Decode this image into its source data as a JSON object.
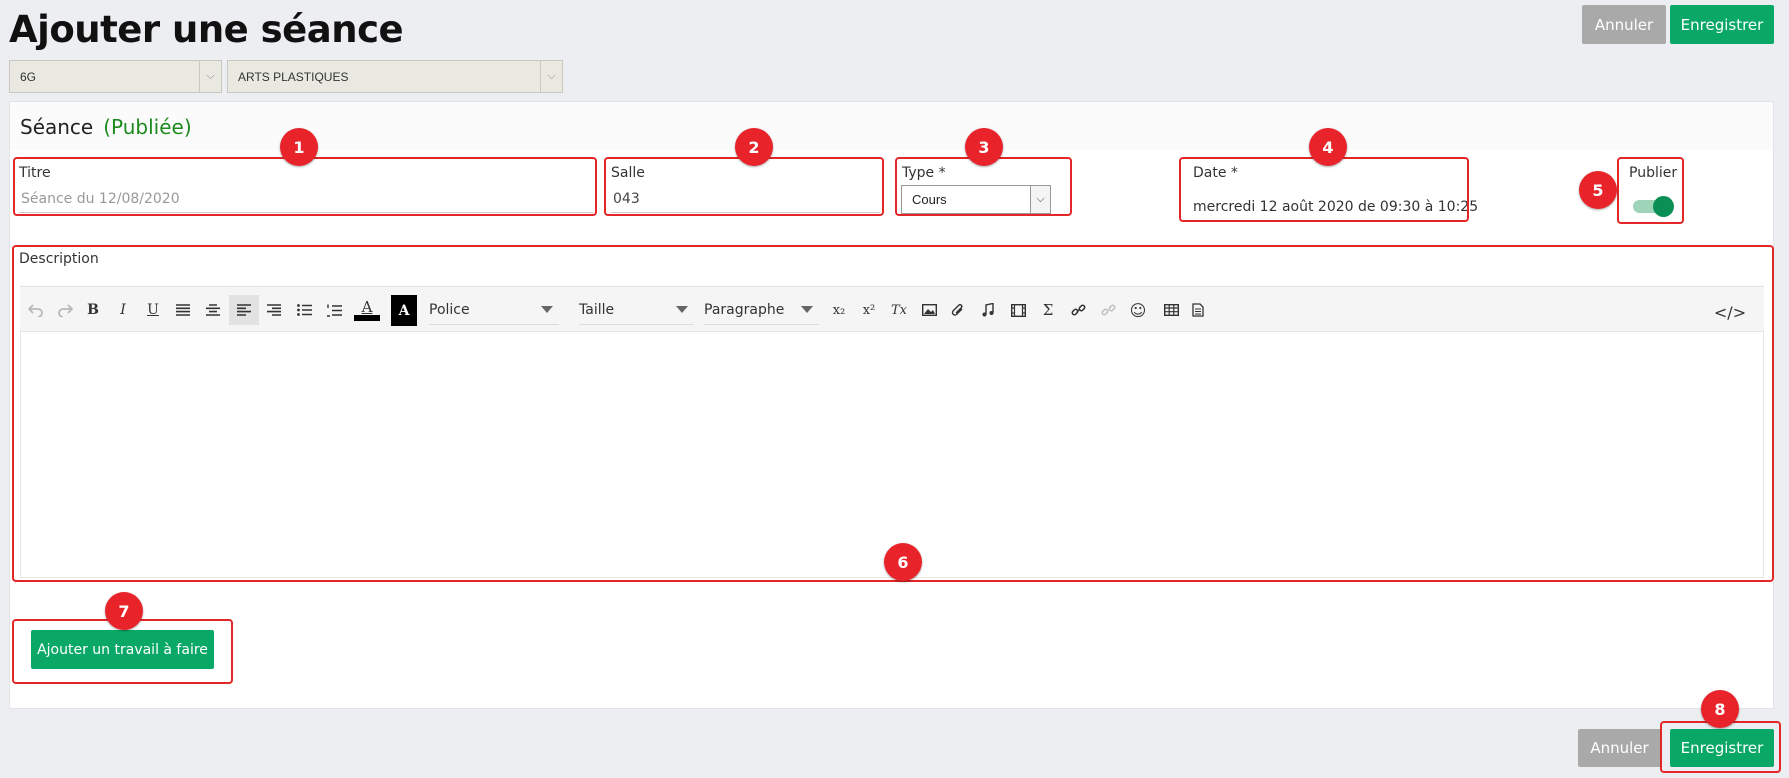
{
  "page": {
    "title": "Ajouter une séance"
  },
  "header_actions": {
    "cancel_label": "Annuler",
    "save_label": "Enregistrer"
  },
  "selectors": {
    "class_value": "6G",
    "subject_value": "ARTS PLASTIQUES"
  },
  "section": {
    "title": "Séance",
    "status": "(Publiée)"
  },
  "form": {
    "titre": {
      "label": "Titre",
      "placeholder": "Séance du 12/08/2020"
    },
    "salle": {
      "label": "Salle",
      "value": "043"
    },
    "type": {
      "label": "Type *",
      "value": "Cours"
    },
    "date": {
      "label": "Date *",
      "value": "mercredi 12 août 2020 de  09:30  à  10:25"
    },
    "publier": {
      "label": "Publier",
      "checked": true
    },
    "description": {
      "label": "Description"
    }
  },
  "toolbar": {
    "font_label": "Police",
    "size_label": "Taille",
    "block_label": "Paragraphe",
    "bold": "B",
    "italic": "I",
    "underline": "U",
    "text_color_glyph": "A",
    "bg_color_glyph": "A",
    "subscript": "x₂",
    "superscript": "x²",
    "clear_format": "Tx",
    "sigma": "Σ",
    "emoji": "☺",
    "code_view": "</>"
  },
  "add_work": {
    "label": "Ajouter un travail à faire"
  },
  "footer_actions": {
    "cancel_label": "Annuler",
    "save_label": "Enregistrer"
  },
  "annotations": [
    "1",
    "2",
    "3",
    "4",
    "5",
    "6",
    "7",
    "8"
  ],
  "colors": {
    "primary_green": "#0aa867",
    "annotation_red": "#e32727",
    "status_green": "#1e8a1e",
    "grey_button": "#a9a9a9"
  }
}
